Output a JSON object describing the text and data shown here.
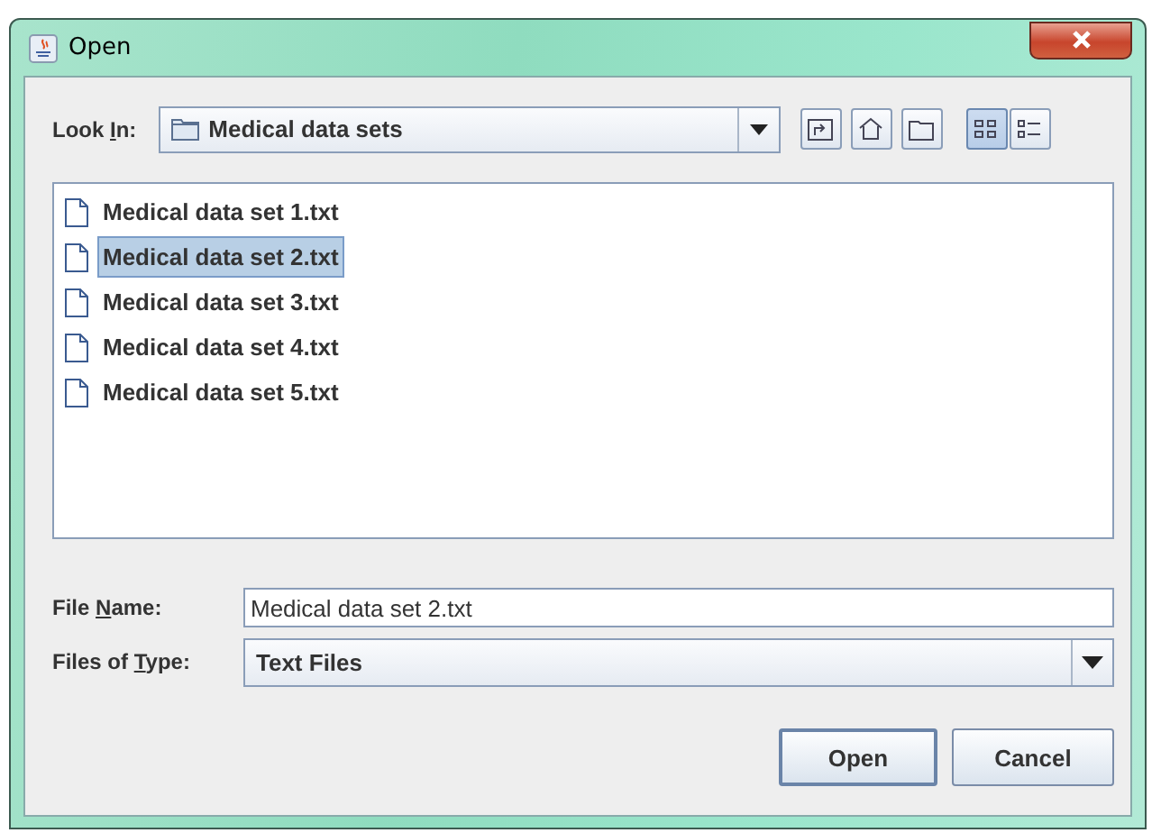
{
  "window": {
    "title": "Open"
  },
  "look_in": {
    "label_parts": [
      "Look ",
      "I",
      "n:"
    ],
    "value": "Medical data sets"
  },
  "view_buttons": [
    {
      "selected": true
    },
    {
      "selected": false
    }
  ],
  "files": [
    {
      "name": "Medical data set 1.txt",
      "selected": false
    },
    {
      "name": "Medical data set 2.txt",
      "selected": true
    },
    {
      "name": "Medical data set 3.txt",
      "selected": false
    },
    {
      "name": "Medical data set 4.txt",
      "selected": false
    },
    {
      "name": "Medical data set 5.txt",
      "selected": false
    }
  ],
  "file_name": {
    "label_parts": [
      "File ",
      "N",
      "ame:"
    ],
    "value": "Medical data set 2.txt"
  },
  "file_type": {
    "label_parts": [
      "Files of ",
      "T",
      "ype:"
    ],
    "value": "Text Files"
  },
  "buttons": [
    {
      "label": "Open",
      "default": true
    },
    {
      "label": "Cancel",
      "default": false
    }
  ]
}
